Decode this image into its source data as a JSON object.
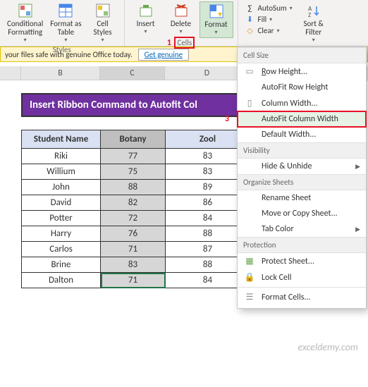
{
  "ribbon": {
    "styles": {
      "cond_fmt": "Conditional\nFormatting",
      "fmt_table": "Format as\nTable",
      "cell_styles": "Cell\nStyles",
      "group": "Styles"
    },
    "cells": {
      "insert": "Insert",
      "delete": "Delete",
      "format": "Format",
      "group": "Cells",
      "marker": "1"
    },
    "editing": {
      "autosum": "AutoSum",
      "fill": "Fill",
      "clear": "Clear",
      "sort": "Sort &\nFilter"
    }
  },
  "msgbar": {
    "text": "your files safe with genuine Office today.",
    "button": "Get genuine"
  },
  "columns": {
    "b": "B",
    "c": "C",
    "d": "D"
  },
  "title": "Insert Ribbon Command to Autofit Col",
  "table": {
    "headers": [
      "Student Name",
      "Botany",
      "Zool"
    ],
    "rows": [
      [
        "Riki",
        "77",
        "83"
      ],
      [
        "Willium",
        "75",
        "83"
      ],
      [
        "John",
        "88",
        "89"
      ],
      [
        "David",
        "82",
        "86"
      ],
      [
        "Potter",
        "72",
        "84"
      ],
      [
        "Harry",
        "76",
        "88"
      ],
      [
        "Carlos",
        "71",
        "87"
      ],
      [
        "Brine",
        "83",
        "88"
      ],
      [
        "Dalton",
        "71",
        "84"
      ]
    ]
  },
  "menu": {
    "cell_size": "Cell Size",
    "row_height": "Row Height...",
    "autofit_row": "AutoFit Row Height",
    "col_width": "Column Width...",
    "autofit_col": "AutoFit Column Width",
    "default_w": "Default Width...",
    "visibility": "Visibility",
    "hide": "Hide & Unhide",
    "organize": "Organize Sheets",
    "rename": "Rename Sheet",
    "move": "Move or Copy Sheet...",
    "tab_color": "Tab Color",
    "protection": "Protection",
    "protect": "Protect Sheet...",
    "lock": "Lock Cell",
    "fmt_cells": "Format Cells...",
    "marker": "3"
  },
  "watermark": "exceldemy.com"
}
